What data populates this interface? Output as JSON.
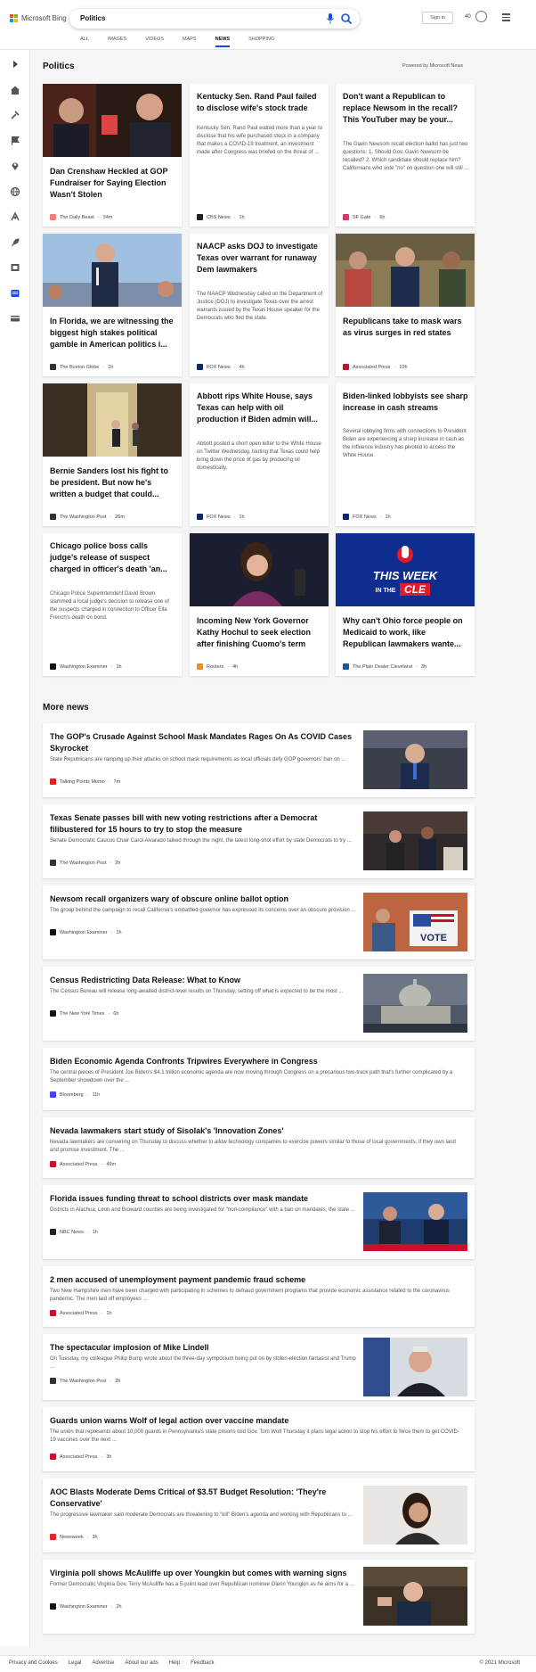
{
  "header": {
    "brand": "Microsoft Bing",
    "search_value": "Politics",
    "signin_label": "Sign in",
    "points": "40",
    "tabs": [
      {
        "label": "ALL"
      },
      {
        "label": "IMAGES"
      },
      {
        "label": "VIDEOS"
      },
      {
        "label": "MAPS"
      },
      {
        "label": "NEWS"
      },
      {
        "label": "SHOPPING"
      }
    ],
    "active_tab": "NEWS",
    "brand_colors": [
      "#f25022",
      "#7fba00",
      "#00a4ef",
      "#ffb900"
    ],
    "accent_color": "#174ae4"
  },
  "sidebar": {
    "icons": [
      "expand-icon",
      "home-icon",
      "tools-icon",
      "flag-icon",
      "location-icon",
      "globe-icon",
      "science-icon",
      "rocket-icon",
      "film-icon",
      "news-icon",
      "card-icon"
    ]
  },
  "politics": {
    "title": "Politics",
    "powered_by": "Powered by Microsoft News",
    "cards": [
      {
        "title": "Dan Crenshaw Heckled at GOP Fundraiser for Saying Election Wasn't Stolen",
        "desc": "",
        "source": "The Daily Beast",
        "time": "34m",
        "logo_color": "#f08080"
      },
      {
        "title": "Kentucky Sen. Rand Paul failed to disclose wife's stock trade",
        "desc": "Kentucky Sen. Rand Paul waited more than a year to disclose that his wife purchased stock in a company that makes a COVID-19 treatment, an investment made after Congress was briefed on the threat of ...",
        "source": "CBS News",
        "time": "1h",
        "logo_color": "#222222"
      },
      {
        "title": "Don't want a Republican to replace Newsom in the recall? This YouTuber may be your...",
        "desc": "The Gavin Newsom recall election ballot has just two questions: 1. Should Gov. Gavin Newsom be recalled? 2. Which candidate should replace him? Californians who vote \"no\" on question one will still ...",
        "source": "SF Gate",
        "time": "6h",
        "logo_color": "#e0355e"
      },
      {
        "title": "In Florida, we are witnessing the biggest high stakes political gamble in American politics i...",
        "desc": "",
        "source": "The Boston Globe",
        "time": "1h",
        "logo_color": "#333333"
      },
      {
        "title": "NAACP asks DOJ to investigate Texas over warrant for runaway Dem lawmakers",
        "desc": "The NAACP Wednesday called on the Department of Justice (DOJ) to investigate Texas over the arrest warrants issued by the Texas House speaker for the Democrats who fled the state.",
        "source": "FOX News",
        "time": "4h",
        "logo_color": "#0a2a6b"
      },
      {
        "title": "Republicans take to mask wars as virus surges in red states",
        "desc": "",
        "source": "Associated Press",
        "time": "10h",
        "logo_color": "#c8102e"
      },
      {
        "title": "Bernie Sanders lost his fight to be president. But now he's written a budget that could...",
        "desc": "",
        "source": "The Washington Post",
        "time": "26m",
        "logo_color": "#333333"
      },
      {
        "title": "Abbott rips White House, says Texas can help with oil production if Biden admin will...",
        "desc": "Abbott posted a short open letter to the White House on Twitter Wednesday, touting that Texas could help bring down the price of gas by producing oil domestically.",
        "source": "FOX News",
        "time": "1h",
        "logo_color": "#0a2a6b"
      },
      {
        "title": "Biden-linked lobbyists see sharp increase in cash streams",
        "desc": "Several lobbying firms with connections to President Biden are experiencing a sharp increase in cash as the influence industry has pivoted to access the White House.",
        "source": "FOX News",
        "time": "1h",
        "logo_color": "#0a2a6b"
      },
      {
        "title": "Chicago police boss calls judge's release of suspect charged in officer's death 'an...",
        "desc": "Chicago Police Superintendent David Brown slammed a local judge's decision to release one of the suspects charged in connection to Officer Ella French's death on bond.",
        "source": "Washington Examiner",
        "time": "1h",
        "logo_color": "#111111"
      },
      {
        "title": "Incoming New York Governor Kathy Hochul to seek election after finishing Cuomo's term",
        "desc": "",
        "source": "Reuters",
        "time": "4h",
        "logo_color": "#f08a24"
      },
      {
        "title": "Why can't Ohio force people on Medicaid to work, like Republican lawmakers wante...",
        "desc": "",
        "source": "The Plain Dealer Cleveland",
        "time": "3h",
        "logo_color": "#1c5a96"
      }
    ]
  },
  "more_news": {
    "title": "More news",
    "items": [
      {
        "title": "The GOP's Crusade Against School Mask Mandates Rages On As COVID Cases Skyrocket",
        "desc": "State Republicans are ramping up their attacks on school mask requirements as local officials defy GOP governors' ban on ...",
        "source": "Talking Points Memo",
        "time": "7m",
        "logo_color": "#d22"
      },
      {
        "title": "Texas Senate passes bill with new voting restrictions after a Democrat filibustered for 15 hours to try to stop the measure",
        "desc": "Senate Democratic Caucus Chair Carol Alvarado talked through the night, the latest long-shot effort by state Democrats to try ...",
        "source": "The Washington Post",
        "time": "2h",
        "logo_color": "#333"
      },
      {
        "title": "Newsom recall organizers wary of obscure online ballot option",
        "desc": "The group behind the campaign to recall California's embattled governor has expressed its concerns over an obscure provision ...",
        "source": "Washington Examiner",
        "time": "1h",
        "logo_color": "#111"
      },
      {
        "title": "Census Redistricting Data Release: What to Know",
        "desc": "The Census Bureau will release long-awaited district-level results on Thursday, setting off what is expected to be the most ...",
        "source": "The New York Times",
        "time": "6h",
        "logo_color": "#111"
      },
      {
        "title": "Biden Economic Agenda Confronts Tripwires Everywhere in Congress",
        "desc": "The central pieces of President Joe Biden's $4.1 trillion economic agenda are now moving through Congress on a precarious two-track path that's further complicated by a September showdown over the ...",
        "source": "Bloomberg",
        "time": "11h",
        "logo_color": "#4b3ff0"
      },
      {
        "title": "Nevada lawmakers start study of Sisolak's 'Innovation Zones'",
        "desc": "Nevada lawmakers are convening on Thursday to discuss whether to allow technology companies to exercise powers similar to those of local governments, if they own land and promise investment. The ...",
        "source": "Associated Press",
        "time": "49m",
        "logo_color": "#c8102e"
      },
      {
        "title": "Florida issues funding threat to school districts over mask mandate",
        "desc": "Districts in Alachua, Leon and Broward counties are being investigated for \"non-compliance\" with a ban on mandates, the state ...",
        "source": "NBC News",
        "time": "1h",
        "logo_color": "#222"
      },
      {
        "title": "2 men accused of unemployment payment pandemic fraud scheme",
        "desc": "Two New Hampshire men have been charged with participating in schemes to defraud government programs that provide economic assistance related to the coronavirus pandemic. The men laid off employees ...",
        "source": "Associated Press",
        "time": "1h",
        "logo_color": "#c8102e"
      },
      {
        "title": "The spectacular implosion of Mike Lindell",
        "desc": "On Tuesday, my colleague Philip Bump wrote about the three-day symposium being put on by stolen-election fantasist and Trump ...",
        "source": "The Washington Post",
        "time": "2h",
        "logo_color": "#333"
      },
      {
        "title": "Guards union warns Wolf of legal action over vaccine mandate",
        "desc": "The union that represents about 10,000 guards in Pennsylvania's state prisons told Gov. Tom Wolf Thursday it plans legal action to stop his effort to force them to get COVID-19 vaccines over the next ...",
        "source": "Associated Press",
        "time": "3h",
        "logo_color": "#c8102e"
      },
      {
        "title": "AOC Blasts Moderate Dems Critical of $3.5T Budget Resolution: 'They're Conservative'",
        "desc": "The progressive lawmaker said moderate Democrats are threatening to \"kill\" Biden's agenda and working with Republicans to ...",
        "source": "Newsweek",
        "time": "3h",
        "logo_color": "#e3262c"
      },
      {
        "title": "Virginia poll shows McAuliffe up over Youngkin but comes with warning signs",
        "desc": "Former Democratic Virginia Gov. Terry McAuliffe has a 5-point lead over Republican nominee Glenn Youngkin as he aims for a ...",
        "source": "Washington Examiner",
        "time": "2h",
        "logo_color": "#111"
      }
    ]
  },
  "footer": {
    "links": [
      "Privacy and Cookies",
      "Legal",
      "Advertise",
      "About our ads",
      "Help",
      "Feedback"
    ],
    "copyright": "© 2021 Microsoft"
  },
  "image_text": {
    "this_week": "THIS WEEK",
    "in_the": "IN THE",
    "cle": "CLE",
    "vote": "VOTE"
  }
}
